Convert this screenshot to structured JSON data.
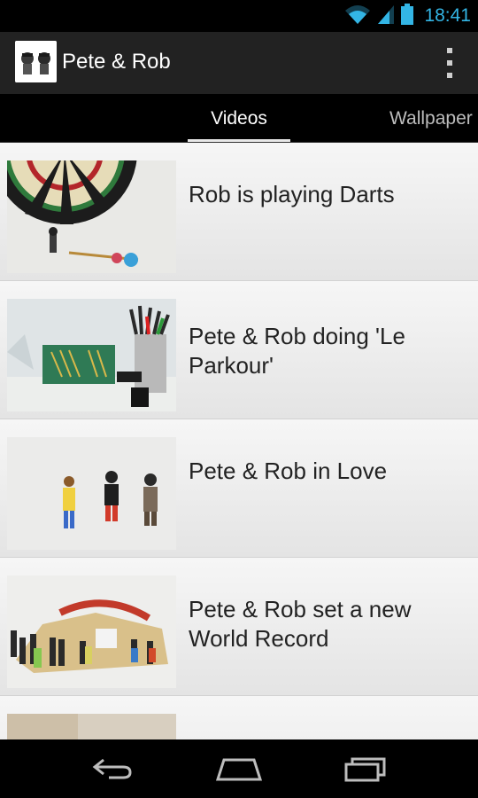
{
  "status_bar": {
    "time": "18:41",
    "icons": [
      "wifi-icon",
      "signal-icon",
      "battery-icon"
    ]
  },
  "action_bar": {
    "title": "Pete & Rob",
    "app_icon": "pete-rob-figures-icon",
    "overflow_icon": "overflow-menu-icon"
  },
  "tabs": [
    {
      "label": "Videos",
      "selected": true
    },
    {
      "label": "Wallpaper",
      "selected": false
    }
  ],
  "videos": [
    {
      "title": "Rob is playing Darts",
      "thumbnail": "darts-thumbnail"
    },
    {
      "title": "Pete & Rob doing 'Le Parkour'",
      "thumbnail": "parkour-thumbnail"
    },
    {
      "title": "Pete & Rob in Love",
      "thumbnail": "love-thumbnail"
    },
    {
      "title": "Pete & Rob set a new World Record",
      "thumbnail": "world-record-thumbnail"
    }
  ],
  "nav_bar": {
    "icons": [
      "back-icon",
      "home-icon",
      "recent-apps-icon"
    ]
  },
  "colors": {
    "accent": "#33b5e5",
    "action_bar": "#222222",
    "list_background": "#f6f6f6"
  }
}
